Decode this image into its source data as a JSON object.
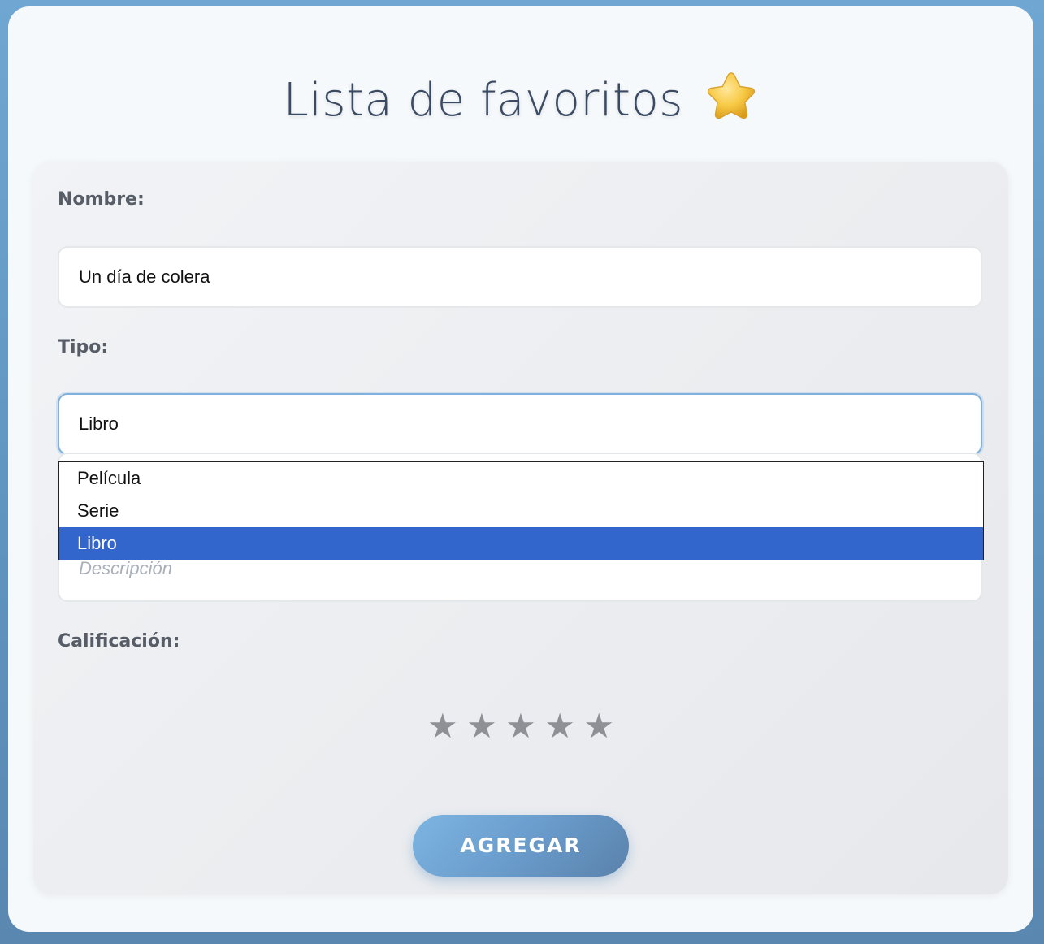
{
  "page": {
    "title": "Lista de favoritos",
    "title_icon": "star-icon"
  },
  "form": {
    "nombre": {
      "label": "Nombre:",
      "value": "Un día de colera"
    },
    "tipo": {
      "label": "Tipo:",
      "value": "Libro",
      "options": [
        "Película",
        "Serie",
        "Libro"
      ],
      "selected_index": 2
    },
    "descripcion": {
      "placeholder": "Descripción"
    },
    "calificacion": {
      "label": "Calificación:",
      "max_stars": 5,
      "rating": 0,
      "star_glyph": "★"
    },
    "submit_label": "AGREGAR"
  },
  "colors": {
    "background": "#6fa6d2",
    "selected_option": "#3366cc",
    "button_gradient_start": "#7db5e1",
    "button_gradient_end": "#5a82ab",
    "star_inactive": "#8e9095"
  }
}
